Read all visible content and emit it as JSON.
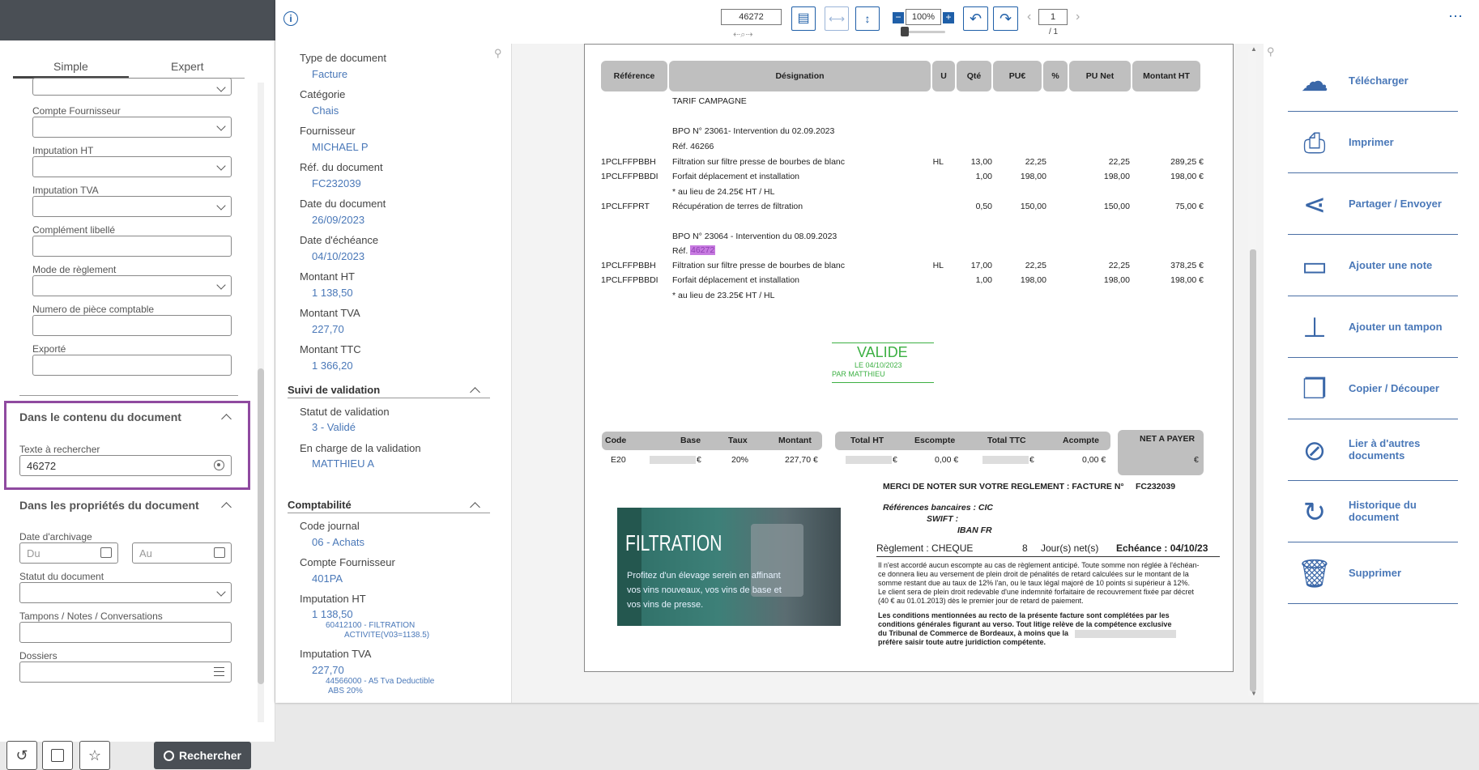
{
  "search_panel": {
    "tabs": [
      "Simple",
      "Expert"
    ],
    "fields": [
      {
        "label": "Compte Fournisseur",
        "value": ""
      },
      {
        "label": "Imputation HT",
        "value": ""
      },
      {
        "label": "Imputation TVA",
        "value": ""
      },
      {
        "label": "Complément libellé",
        "value": ""
      },
      {
        "label": "Mode de règlement",
        "value": ""
      },
      {
        "label": "Numero de pièce comptable",
        "value": ""
      },
      {
        "label": "Exporté",
        "value": ""
      }
    ],
    "content_section": {
      "title": "Dans le contenu du document",
      "text_label": "Texte à rechercher",
      "text_value": "46272"
    },
    "props_section": {
      "title": "Dans les propriétés du document",
      "archive_date_label": "Date d'archivage",
      "date_from_placeholder": "Du",
      "date_to_placeholder": "Au",
      "status_label": "Statut du document",
      "stamps_label": "Tampons / Notes / Conversations",
      "folders_label": "Dossiers"
    },
    "search_button": "Rechercher"
  },
  "toolbar": {
    "search_value": "46272",
    "zoom": "100%",
    "page": "1",
    "page_total": "/ 1"
  },
  "properties": {
    "items": [
      {
        "label": "Type de document",
        "value": "Facture"
      },
      {
        "label": "Catégorie",
        "value": "Chais"
      },
      {
        "label": "Fournisseur",
        "value": "MICHAEL P"
      },
      {
        "label": "Réf. du document",
        "value": "FC232039"
      },
      {
        "label": "Date du document",
        "value": "26/09/2023"
      },
      {
        "label": "Date d'échéance",
        "value": "04/10/2023"
      },
      {
        "label": "Montant HT",
        "value": "1 138,50"
      },
      {
        "label": "Montant TVA",
        "value": "227,70"
      },
      {
        "label": "Montant TTC",
        "value": "1 366,20"
      }
    ],
    "validation": {
      "title": "Suivi de validation",
      "status_label": "Statut de validation",
      "status_value": "3 - Validé",
      "owner_label": "En charge de la validation",
      "owner_value": "MATTHIEU A"
    },
    "accounting": {
      "title": "Comptabilité",
      "journal_label": "Code journal",
      "journal_value": "06 - Achats",
      "supplier_label": "Compte Fournisseur",
      "supplier_value": "401PA",
      "ht_label": "Imputation HT",
      "ht_value": "1 138,50",
      "ht_sub1": "60412100 - FILTRATION",
      "ht_sub2": "ACTIVITE(V03=1138.5)",
      "tva_label": "Imputation TVA",
      "tva_value": "227,70",
      "tva_sub1": "44566000 - A5 Tva Deductible",
      "tva_sub2": "ABS 20%"
    }
  },
  "invoice": {
    "headers": [
      "Référence",
      "Désignation",
      "U",
      "Qté",
      "PU€",
      "%",
      "PU Net",
      "Montant HT"
    ],
    "tarif": "TARIF CAMPAGNE",
    "bpo1": "BPO N° 23061- Intervention du 02.09.2023",
    "ref1": "Réf. 46266",
    "rows1": [
      {
        "ref": "1PCLFFPBBH",
        "des": "Filtration sur filtre presse de bourbes de blanc",
        "u": "HL",
        "qte": "13,00",
        "pu": "22,25",
        "punet": "22,25",
        "mt": "289,25 €"
      },
      {
        "ref": "1PCLFFPBBDI",
        "des": "Forfait déplacement et installation",
        "u": "",
        "qte": "1,00",
        "pu": "198,00",
        "punet": "198,00",
        "mt": "198,00 €"
      }
    ],
    "note1": "* au lieu de 24.25€ HT / HL",
    "row_prt": {
      "ref": "1PCLFFPRT",
      "des": "Récupération de terres de filtration",
      "qte": "0,50",
      "pu": "150,00",
      "punet": "150,00",
      "mt": "75,00 €"
    },
    "bpo2": "BPO N° 23064 - Intervention du 08.09.2023",
    "ref2_label": "Réf.",
    "ref2_value": "46272",
    "rows2": [
      {
        "ref": "1PCLFFPBBH",
        "des": "Filtration sur filtre presse de bourbes de blanc",
        "u": "HL",
        "qte": "17,00",
        "pu": "22,25",
        "punet": "22,25",
        "mt": "378,25 €"
      },
      {
        "ref": "1PCLFFPBBDI",
        "des": "Forfait déplacement et installation",
        "u": "",
        "qte": "1,00",
        "pu": "198,00",
        "punet": "198,00",
        "mt": "198,00 €"
      }
    ],
    "note2": "* au lieu de 23.25€ HT / HL",
    "stamp": {
      "title": "VALIDE",
      "date": "LE 04/10/2023",
      "by": "PAR MATTHIEU"
    },
    "totals_headers": [
      "Code",
      "Base",
      "Taux",
      "Montant",
      "Total HT",
      "Escompte",
      "Total TTC",
      "Acompte",
      "NET A PAYER"
    ],
    "totals_values": {
      "code": "E20",
      "base": "€",
      "taux": "20%",
      "montant": "227,70 €",
      "total_ht": "€",
      "escompte": "0,00 €",
      "total_ttc": "€",
      "acompte": "0,00 €",
      "net": "€"
    },
    "merci": "MERCI DE NOTER SUR VOTRE REGLEMENT : FACTURE N°",
    "facture_no": "FC232039",
    "bank_ref": "Références bancaires : CIC",
    "swift": "SWIFT :",
    "iban": "IBAN FR",
    "reglement": "Règlement :  CHEQUE",
    "days": "8",
    "jours": "Jour(s) net(s)",
    "echeance": "Echéance : 04/10/23",
    "legal1": "Il n'est accordé aucun escompte au cas de règlement anticipé. Toute somme non réglée à l'échéan-",
    "legal2": "ce donnera lieu au versement de plein droit de pénalités de retard calculées sur le montant de la",
    "legal3": "somme restant due au taux de 12% l'an, ou le taux légal majoré de 10 points si supérieur à 12%.",
    "legal4": "Le client sera de plein droit redevable d'une indemnité forfaitaire de recouvrement fixée par décret",
    "legal5": "(40 € au 01.01.2013) dès le premier jour de retard de paiement.",
    "legal6": "Les conditions mentionnées au recto de la présente facture sont complétées par les",
    "legal7": "conditions générales figurant au verso. Tout litige relève de la compétence exclusive",
    "legal8": "du Tribunal de Commerce de Bordeaux, à moins que la",
    "legal9": "préfère saisir toute autre juridiction compétente.",
    "ad_title": "FILTRATION",
    "ad_line1": "Profitez d'un élevage serein en affinant",
    "ad_line2": "vos vins nouveaux, vos vins de base et",
    "ad_line3": "vos vins de presse."
  },
  "actions": [
    {
      "label": "Télécharger",
      "icon": "cloud-download-icon"
    },
    {
      "label": "Imprimer",
      "icon": "printer-icon"
    },
    {
      "label": "Partager / Envoyer",
      "icon": "share-icon"
    },
    {
      "label": "Ajouter une note",
      "icon": "note-icon"
    },
    {
      "label": "Ajouter un tampon",
      "icon": "stamp-icon"
    },
    {
      "label": "Copier / Découper",
      "icon": "copy-icon"
    },
    {
      "label": "Lier à d'autres documents",
      "icon": "link-icon"
    },
    {
      "label": "Historique du document",
      "icon": "history-icon"
    },
    {
      "label": "Supprimer",
      "icon": "trash-icon"
    }
  ]
}
